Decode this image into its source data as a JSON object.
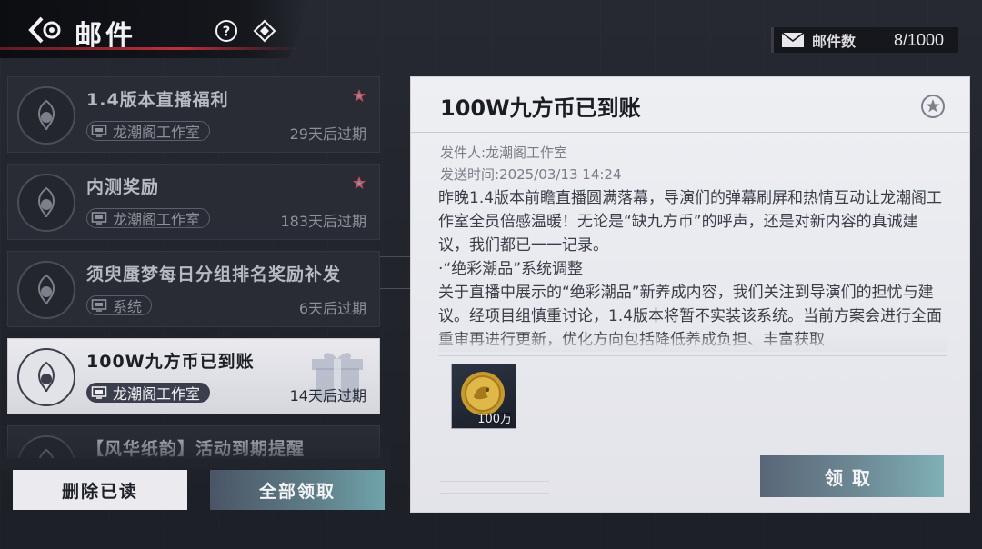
{
  "header": {
    "title": "邮件"
  },
  "mail_count": {
    "label": "邮件数",
    "value": "8/1000"
  },
  "mail_list": [
    {
      "subject": "1.4版本直播福利",
      "sender": "龙潮阁工作室",
      "expiry": "29天后过期",
      "starred": true
    },
    {
      "subject": "内测奖励",
      "sender": "龙潮阁工作室",
      "expiry": "183天后过期",
      "starred": true
    },
    {
      "subject": "须臾蜃梦每日分组排名奖励补发",
      "sender": "系统",
      "expiry": "6天后过期",
      "starred": false
    },
    {
      "subject": "100W九方币已到账",
      "sender": "龙潮阁工作室",
      "expiry": "14天后过期",
      "starred": false,
      "selected": true
    },
    {
      "subject": "【风华纸韵】活动到期提醒",
      "sender": "",
      "expiry": "",
      "starred": false
    }
  ],
  "buttons": {
    "delete_read": "删除已读",
    "claim_all": "全部领取",
    "claim": "领取"
  },
  "detail": {
    "title": "100W九方币已到账",
    "sender": "发件人:龙潮阁工作室",
    "sent_time": "发送时间:2025/03/13 14:24",
    "body": [
      "昨晚1.4版本前瞻直播圆满落幕，导演们的弹幕刷屏和热情互动让龙潮阁工作室全员倍感温暖！无论是“缺九方币”的呼声，还是对新内容的真诚建议，我们都已一一记录。",
      "·“绝彩潮品”系统调整",
      "关于直播中展示的“绝彩潮品”新养成内容，我们关注到导演们的担忧与建议。经项目组慎重讨论，1.4版本将暂不实装该系统。当前方案会进行全面重审再进行更新，优化方向包括降低养成负担、丰富获取"
    ],
    "attachment": {
      "icon": "gold-coin-icon",
      "quantity": "100万"
    }
  },
  "colors": {
    "accent_red": "#c0303c",
    "star_red": "#d24a55",
    "star_blue": "#5aa7c9"
  }
}
